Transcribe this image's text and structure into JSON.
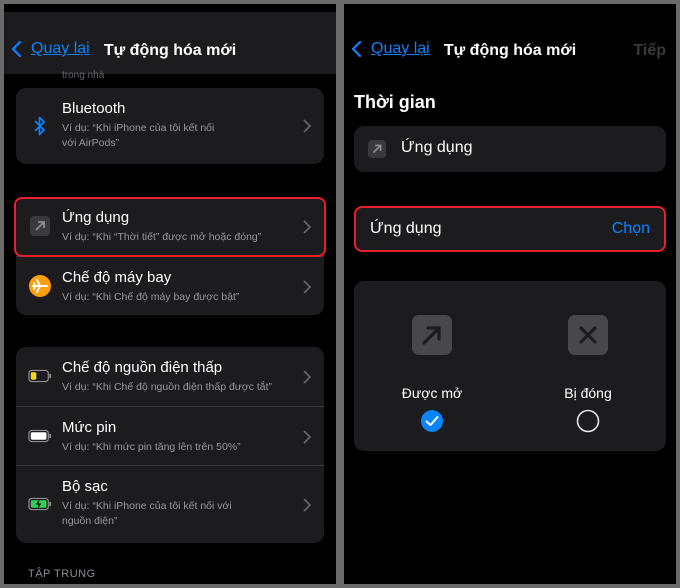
{
  "left": {
    "nav": {
      "back_label": "Quay lại",
      "title": "Tự động hóa mới",
      "hint": "trong nhà"
    },
    "group1": {
      "bluetooth": {
        "title": "Bluetooth",
        "sub_line1": "Ví dụ: “Khi iPhone của tôi kết nối",
        "sub_line2": "với AirPods”"
      }
    },
    "group2": {
      "app": {
        "title": "Ứng dụng",
        "sub": "Ví dụ: “Khi “Thời tiết” được mở hoặc đóng”"
      },
      "airplane": {
        "title": "Chế độ máy bay",
        "sub": "Ví dụ: “Khi Chế độ máy bay được bật”"
      }
    },
    "group3": {
      "lowpower": {
        "title": "Chế độ nguồn điện thấp",
        "sub": "Ví dụ: “Khi Chế độ nguồn điện thấp được tắt”"
      },
      "battery": {
        "title": "Mức pin",
        "sub": "Ví dụ: “Khi mức pin tăng lên trên 50%”"
      },
      "charger": {
        "title": "Bộ sạc",
        "sub_line1": "Ví dụ: “Khi iPhone của tôi kết nối với",
        "sub_line2": "nguồn điện”"
      }
    },
    "section_label": "TẬP TRUNG"
  },
  "right": {
    "nav": {
      "back_label": "Quay lại",
      "title": "Tự động hóa mới",
      "next_label": "Tiếp"
    },
    "heading": "Thời gian",
    "app_box_label": "Ứng dụng",
    "select_row": {
      "label": "Ứng dụng",
      "action": "Chọn"
    },
    "options": {
      "opened": {
        "label": "Được mở",
        "selected": true
      },
      "closed": {
        "label": "Bị đóng",
        "selected": false
      }
    }
  },
  "colors": {
    "accent": "#0a84ff",
    "highlight": "#e8202a",
    "airplane": "#ff9f0a",
    "battery_low": "#ffd60a",
    "charging": "#30d158"
  }
}
